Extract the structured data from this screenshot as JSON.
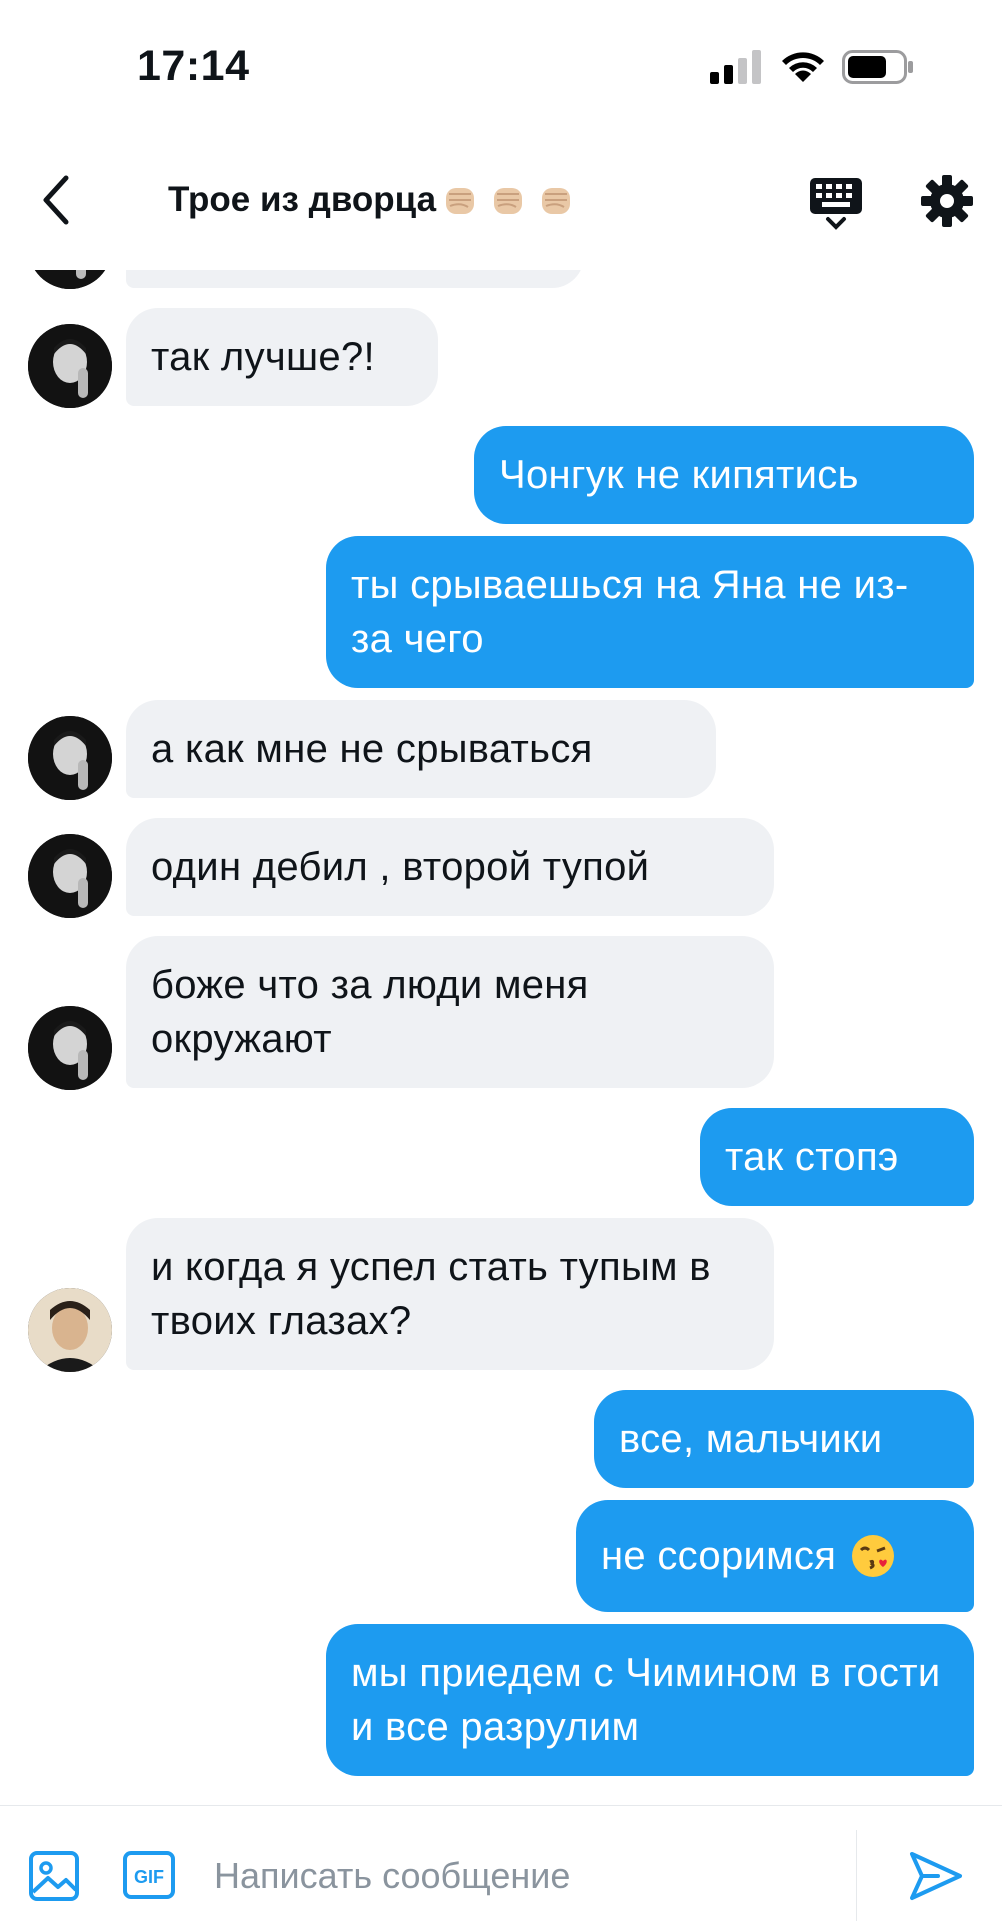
{
  "status_bar": {
    "time": "17:14"
  },
  "header": {
    "back_icon": "chevron-left-icon",
    "title": "Трое из дворца",
    "title_emojis": [
      "fist-emoji",
      "fist-emoji",
      "fist-emoji"
    ],
    "keyboard_icon": "keyboard-icon",
    "settings_icon": "gear-icon"
  },
  "messages": [
    {
      "id": "m0",
      "side": "in",
      "text": ""
    },
    {
      "id": "m1",
      "side": "in",
      "text": "так лучше?!"
    },
    {
      "id": "m2",
      "side": "out",
      "text": "Чонгук не кипятись"
    },
    {
      "id": "m3",
      "side": "out",
      "text": "ты срываешься на Яна не из-за чего"
    },
    {
      "id": "m4",
      "side": "in",
      "text": "а как мне не срываться"
    },
    {
      "id": "m5",
      "side": "in",
      "text": "один дебил , второй тупой"
    },
    {
      "id": "m6",
      "side": "in",
      "text": "боже что за люди меня окружают"
    },
    {
      "id": "m7",
      "side": "out",
      "text": "так стопэ"
    },
    {
      "id": "m8",
      "side": "in",
      "text": "и когда я успел стать тупым в твоих глазах?"
    },
    {
      "id": "m9",
      "side": "out",
      "text": "все, мальчики"
    },
    {
      "id": "m10",
      "side": "out",
      "text": "не ссоримся",
      "emoji": "kiss-emoji"
    },
    {
      "id": "m11",
      "side": "out",
      "text": "мы приедем с Чимином в гости и все разрулим"
    }
  ],
  "composer": {
    "placeholder": "Написать сообщение",
    "image_icon": "image-icon",
    "gif_label": "GIF",
    "send_icon": "send-icon"
  },
  "colors": {
    "accent": "#1d9bf0",
    "incoming_bubble": "#eff1f4",
    "text": "#0f1419"
  }
}
